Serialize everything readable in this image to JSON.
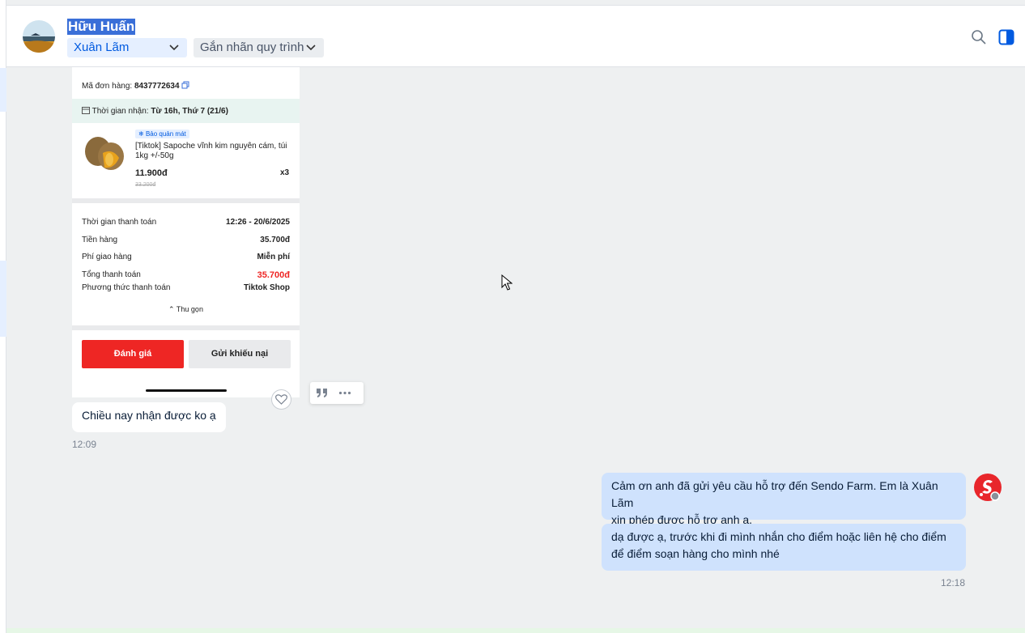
{
  "header": {
    "contact_name": "Hữu Huấn",
    "assignee": "Xuân Lãm",
    "tag_button": "Gắn nhãn quy trình",
    "icons": [
      "search-icon",
      "toggle-panel-icon",
      "chevron-down-icon"
    ],
    "accent_color": "#005ae0"
  },
  "order": {
    "order_code_label": "Mã đơn hàng:",
    "order_code": "8437772634",
    "receive_label": "Thời gian nhận:",
    "receive_time": "Từ 16h, Thứ 7 (21/6)",
    "badge": "Bảo quản mát",
    "product_name_line1": "[Tiktok] Sapoche vĩnh kim nguyên cám, túi",
    "product_name_line2": "1kg +/-50g",
    "price": "11.900đ",
    "old_price": "33.200đ",
    "quantity": "x3",
    "payment_time_label": "Thời gian thanh toán",
    "payment_time": "12:26 - 20/6/2025",
    "goods_label": "Tiền hàng",
    "goods_value": "35.700đ",
    "shipping_label": "Phí giao hàng",
    "shipping_value": "Miễn phí",
    "total_label": "Tổng thanh toán",
    "total_value": "35.700đ",
    "method_label": "Phương thức thanh toán",
    "method_value": "Tiktok Shop",
    "collapse": "Thu gọn",
    "rate_button": "Đánh giá",
    "complaint_button": "Gửi khiếu nại"
  },
  "messages": {
    "incoming_text": "Chiều nay nhận được ko ạ",
    "incoming_time": "12:09",
    "outgoing_1_line1": "Cảm ơn anh đã gửi yêu cầu hỗ trợ đến Sendo Farm. Em là Xuân Lãm",
    "outgoing_1_line2": "xin phép được hỗ trợ anh ạ.",
    "outgoing_2_line1": "dạ được ạ, trước khi đi mình nhắn cho điểm hoặc liên hệ cho điểm",
    "outgoing_2_line2": "để điểm soạn hàng cho mình nhé",
    "outgoing_time": "12:18"
  },
  "colors": {
    "outgoing_bubble": "#cfe2fd",
    "incoming_bubble": "#ffffff",
    "price_red": "#ee2624"
  }
}
